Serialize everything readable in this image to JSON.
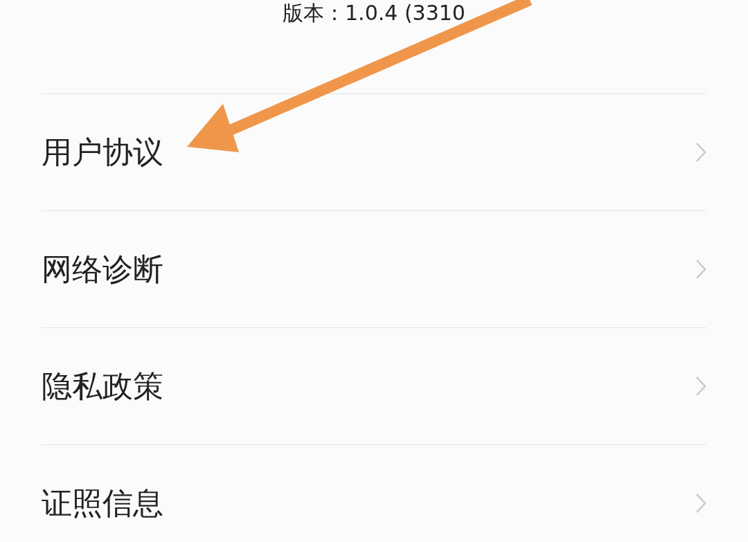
{
  "version_label": "版本：1.0.4 (3310",
  "menu_items": [
    {
      "label": "用户协议"
    },
    {
      "label": "网络诊断"
    },
    {
      "label": "隐私政策"
    },
    {
      "label": "证照信息"
    }
  ]
}
